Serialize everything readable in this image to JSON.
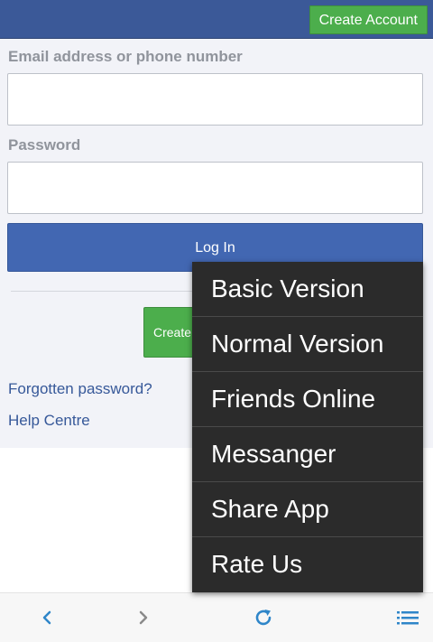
{
  "header": {
    "create_account_label": "Create Account",
    "bg_color": "#3b5998"
  },
  "login_form": {
    "email_label": "Email address or phone number",
    "email_value": "",
    "password_label": "Password",
    "password_value": "",
    "login_label": "Log In",
    "create_button_label": "Create New Account",
    "forgot_label": "Forgotten password?",
    "help_label": "Help Centre"
  },
  "overflow_menu": {
    "items": [
      {
        "label": "Basic Version"
      },
      {
        "label": "Normal Version"
      },
      {
        "label": "Friends Online"
      },
      {
        "label": "Messanger"
      },
      {
        "label": "Share App"
      },
      {
        "label": "Rate Us"
      }
    ]
  },
  "bottom_nav": {
    "icons": [
      "back-icon",
      "forward-icon",
      "reload-icon",
      "menu-icon"
    ],
    "icon_color": "#2f86c9"
  }
}
